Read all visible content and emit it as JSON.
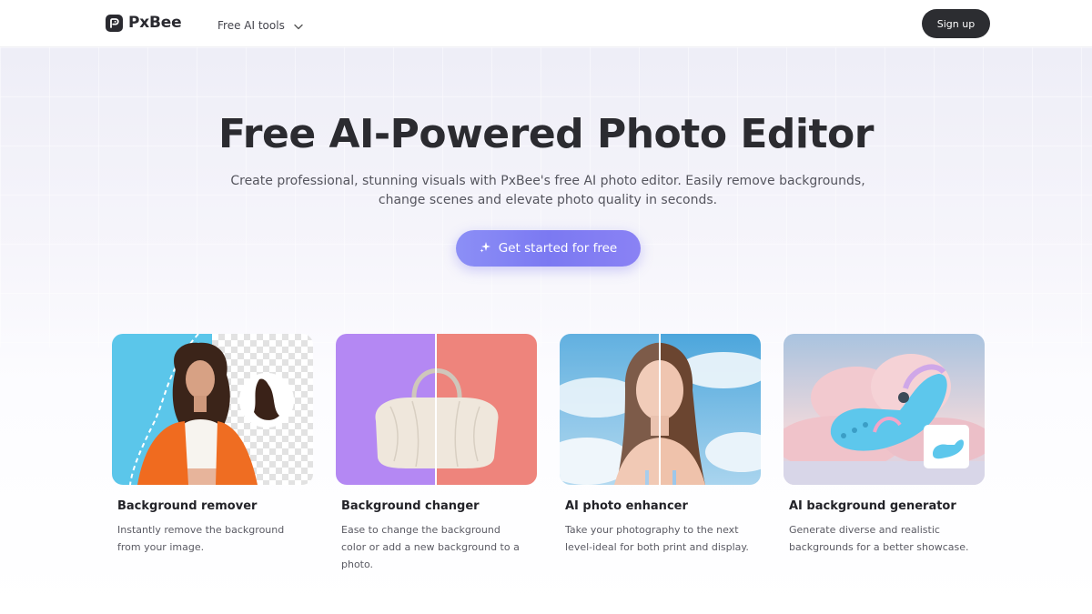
{
  "header": {
    "brand": "PxBee",
    "nav_tools_label": "Free AI tools",
    "signup_label": "Sign up"
  },
  "hero": {
    "title": "Free AI-Powered Photo Editor",
    "subtitle": "Create professional, stunning visuals with PxBee's free AI photo editor. Easily remove backgrounds, change scenes and elevate photo quality in seconds.",
    "cta_label": "Get started for free"
  },
  "cards": [
    {
      "title": "Background remover",
      "description": "Instantly remove the background from your image."
    },
    {
      "title": "Background changer",
      "description": "Ease to change the background color or add a new background to a photo."
    },
    {
      "title": "AI photo enhancer",
      "description": "Take your photography to the next level-ideal for both print and display."
    },
    {
      "title": "AI background generator",
      "description": "Generate diverse and realistic backgrounds for a better showcase."
    }
  ],
  "colors": {
    "cta_gradient_start": "#8c8ff6",
    "cta_gradient_end": "#7b79f2",
    "signup_bg": "#2c2d31",
    "changer_purple": "#b488f3",
    "changer_coral": "#ee847c",
    "remover_blue": "#5bc6ea"
  },
  "icons": {
    "logo": "pxbee-logo-icon",
    "nav_dropdown": "chevron-down-icon",
    "cta": "sparkle-icon"
  }
}
